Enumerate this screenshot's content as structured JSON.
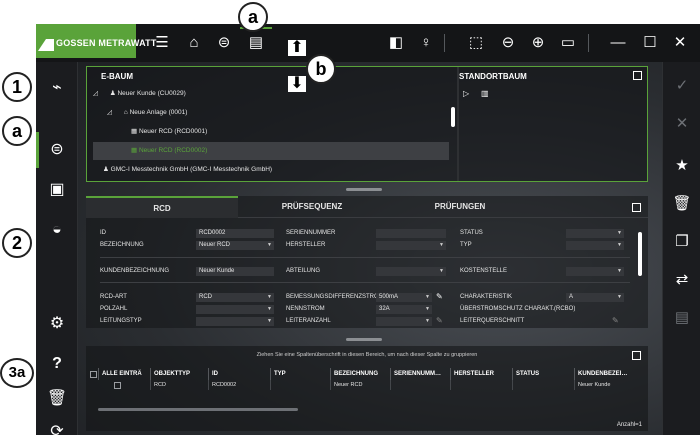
{
  "callouts": {
    "a_top": "a",
    "b": "b",
    "one": "1",
    "a_left": "a",
    "two": "2",
    "three_a": "3a"
  },
  "app": {
    "brand": "GOSSEN METRAWATT",
    "accent": "#5aa33a"
  },
  "toolbar": {
    "icons": [
      "menu-icon",
      "home-icon",
      "device-icon",
      "form-icon",
      "sidebar-toggle-icon",
      "bulb-icon",
      "select-icon",
      "zoom-out-icon",
      "zoom-in-icon",
      "fit-icon",
      "minimize-icon",
      "maximize-icon",
      "close-icon"
    ]
  },
  "tree": {
    "title": "E-BAUM",
    "location_title": "STANDORTBAUM",
    "rows": [
      {
        "label": "Neuer Kunde (CU0029)"
      },
      {
        "label": "Neue Anlage (0001)"
      },
      {
        "label": "Neuer RCD (RCD0001)"
      },
      {
        "label": "Neuer RCD (RCD0002)"
      },
      {
        "label": "GMC-I Messtechnik GmbH (GMC-I Messtechnik GmbH)"
      }
    ]
  },
  "detail": {
    "tabs": [
      {
        "label": "RCD"
      },
      {
        "label": "PRÜFSEQUENZ"
      },
      {
        "label": "PRÜFUNGEN"
      }
    ],
    "fields": {
      "id": {
        "label": "ID",
        "value": "RCD0002"
      },
      "bezeichnung": {
        "label": "BEZEICHNUNG",
        "value": "Neuer RCD"
      },
      "seriennummer": {
        "label": "SERIENNUMMER",
        "value": ""
      },
      "hersteller": {
        "label": "HERSTELLER",
        "value": ""
      },
      "status": {
        "label": "STATUS",
        "value": ""
      },
      "typ": {
        "label": "TYP",
        "value": ""
      },
      "kundenbezeichnung": {
        "label": "KUNDENBEZEICHNUNG",
        "value": "Neuer Kunde"
      },
      "abteilung": {
        "label": "ABTEILUNG",
        "value": ""
      },
      "kostenstelle": {
        "label": "KOSTENSTELLE",
        "value": ""
      },
      "rcd_art": {
        "label": "RCD-ART",
        "value": "RCD"
      },
      "polzahl": {
        "label": "POLZAHL",
        "value": ""
      },
      "leitungstyp": {
        "label": "LEITUNGSTYP",
        "value": ""
      },
      "bemessung": {
        "label": "BEMESSUNGSDIFFERENZSTROM",
        "value": "500mA"
      },
      "nennstrom": {
        "label": "NENNSTROM",
        "value": "32A"
      },
      "leiteranzahl": {
        "label": "LEITERANZAHL",
        "value": ""
      },
      "charakteristik": {
        "label": "CHARAKTERISTIK",
        "value": "A"
      },
      "ueberstrom": {
        "label": "ÜBERSTROMSCHUTZ CHARAKT.(RCBO)",
        "value": ""
      },
      "leiterquerschnitt": {
        "label": "LEITERQUERSCHNITT",
        "value": ""
      }
    }
  },
  "table": {
    "group_hint": "Ziehen Sie eine Spaltenüberschrift in diesen Bereich, um nach dieser Spalte zu gruppieren",
    "columns": [
      "ALLE EINTRÄ",
      "OBJEKTTYP",
      "ID",
      "TYP",
      "BEZEICHNUNG",
      "SERIENNUMM…",
      "HERSTELLER",
      "STATUS",
      "KUNDENBEZEI…"
    ],
    "row": [
      "",
      "RCD",
      "RCD0002",
      "",
      "Neuer RCD",
      "",
      "",
      "",
      "Neuer Kunde"
    ],
    "count": "Anzahl=1"
  }
}
